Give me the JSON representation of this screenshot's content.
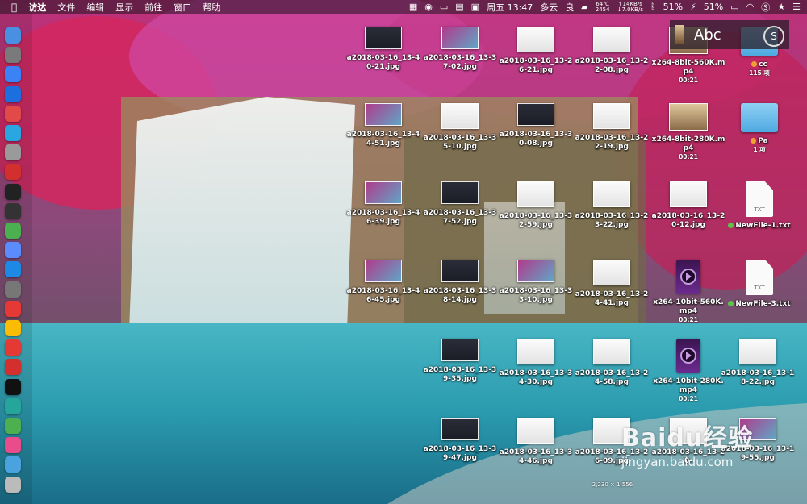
{
  "menubar": {
    "app_name": "访达",
    "menus": [
      "文件",
      "编辑",
      "显示",
      "前往",
      "窗口",
      "帮助"
    ],
    "status": {
      "datetime": "周五 13:47",
      "weather": "多云",
      "air_quality": "良",
      "temperature": "64℃",
      "cpu": "2454",
      "net_up": "↑14KB/s",
      "net_down": "↓7.0KB/s",
      "battery_a": "51%",
      "battery_b": "51%"
    },
    "icons": [
      "apple-icon",
      "grid-icon",
      "wechat-icon",
      "monitor-icon",
      "menu-icon",
      "picture-icon",
      "bell-icon",
      "car-icon",
      "bluetooth-icon",
      "battery-icon",
      "wifi-icon",
      "s-icon",
      "star-icon",
      "list-icon"
    ]
  },
  "input_panel": {
    "text": "Abc"
  },
  "dock": {
    "icons": [
      "finder-icon",
      "launchpad-icon",
      "safari-icon",
      "preview-icon",
      "calendar-icon",
      "migration-icon",
      "photo-icon",
      "netease-icon",
      "terminal-icon",
      "console-icon",
      "maps-icon",
      "siri-icon",
      "appstore-icon",
      "prefs-icon",
      "yandex-icon",
      "chrome-icon",
      "weibo-icon",
      "vivaldi-icon",
      "iterm-icon",
      "swap-icon",
      "wechat-icon",
      "cleanmymac-icon",
      "folder-icon",
      "trash-icon"
    ]
  },
  "desktop": {
    "items": [
      {
        "label": "a2018-03-16_13-40-21.jpg",
        "type": "dark"
      },
      {
        "label": "a2018-03-16_13-37-02.jpg",
        "type": "pink"
      },
      {
        "label": "a2018-03-16_13-26-21.jpg",
        "type": "white"
      },
      {
        "label": "a2018-03-16_13-22-08.jpg",
        "type": "white"
      },
      {
        "label": "x264-8bit-560K.mp4",
        "sub": "00:21",
        "type": "anime"
      },
      {
        "label": "cc",
        "sub": "115 项",
        "type": "folder",
        "dot": "#f0a030"
      },
      {
        "label": "a2018-03-16_13-44-51.jpg",
        "type": "pink"
      },
      {
        "label": "a2018-03-16_13-35-10.jpg",
        "type": "white"
      },
      {
        "label": "a2018-03-16_13-30-08.jpg",
        "type": "dark"
      },
      {
        "label": "a2018-03-16_13-22-19.jpg",
        "type": "white"
      },
      {
        "label": "x264-8bit-280K.mp4",
        "sub": "00:21",
        "type": "anime"
      },
      {
        "label": "Pa",
        "sub": "1 项",
        "type": "folder",
        "dot": "#f0a030"
      },
      {
        "label": "a2018-03-16_13-46-39.jpg",
        "type": "pink"
      },
      {
        "label": "a2018-03-16_13-37-52.jpg",
        "type": "dark"
      },
      {
        "label": "a2018-03-16_13-32-59.jpg",
        "type": "white"
      },
      {
        "label": "a2018-03-16_13-23-22.jpg",
        "type": "white"
      },
      {
        "label": "a2018-03-16_13-20-12.jpg",
        "type": "white"
      },
      {
        "label": "NewFile-1.txt",
        "type": "doc",
        "dot": "#5ec24a"
      },
      {
        "label": "a2018-03-16_13-46-45.jpg",
        "type": "pink"
      },
      {
        "label": "a2018-03-16_13-38-14.jpg",
        "type": "dark"
      },
      {
        "label": "a2018-03-16_13-33-10.jpg",
        "type": "pink"
      },
      {
        "label": "a2018-03-16_13-24-41.jpg",
        "type": "white"
      },
      {
        "label": "x264-10bit-560K.mp4",
        "sub": "00:21",
        "type": "video"
      },
      {
        "label": "NewFile-3.txt",
        "type": "doc",
        "dot": "#5ec24a"
      },
      {
        "label": "a2018-03-16_13-39-35.jpg",
        "type": "dark"
      },
      {
        "label": "a2018-03-16_13-34-30.jpg",
        "type": "white"
      },
      {
        "label": "a2018-03-16_13-24-58.jpg",
        "type": "white"
      },
      {
        "label": "x264-10bit-280K.mp4",
        "sub": "00:21",
        "type": "video"
      },
      {
        "label": "a2018-03-16_13-18-22.jpg",
        "type": "white"
      },
      {
        "label": "a2018-03-16_13-39-47.jpg",
        "type": "dark"
      },
      {
        "label": "a2018-03-16_13-34-46.jpg",
        "type": "white"
      },
      {
        "label": "a2018-03-16_13-26-09.jpg",
        "type": "white"
      },
      {
        "label": "a2018-03-16_13-20-",
        "type": "white"
      },
      {
        "label": "a2018-03-16_13-19-55.jpg",
        "type": "pink"
      }
    ],
    "selected_dimension": "2,230 × 1,556",
    "doc_badge": "TXT"
  },
  "watermark": {
    "brand": "Baidu经验",
    "url": "jingyan.baidu.com"
  },
  "colors": {
    "menubar": "#2a1a2c",
    "label_text": "#ffffff"
  }
}
